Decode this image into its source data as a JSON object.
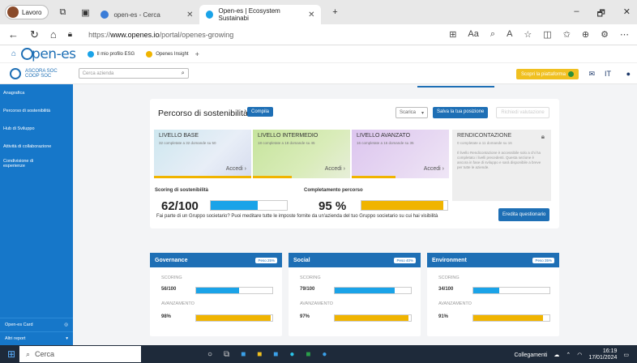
{
  "browser": {
    "profile_label": "Lavoro",
    "tabs": [
      {
        "label": "open-es - Cerca",
        "active": false
      },
      {
        "label": "Open-es | Ecosystem Sustainabi",
        "active": true
      }
    ],
    "new_tab": "+",
    "url_prefix": "https://",
    "url_domain": "www.openes.io",
    "url_path": "/portal/openes-growing",
    "window_controls": [
      "–",
      "🗗",
      "✕"
    ]
  },
  "app": {
    "logo": "pen-es",
    "tabs": [
      {
        "label": "Il mio profilo ESG"
      },
      {
        "label": "Openes Insight"
      }
    ],
    "add_tab": "+",
    "org_line1": "ASCORA SOC",
    "org_line2": "COOP SOC",
    "search_placeholder": "Cerca azienda",
    "yellow_button": "Scopri la piattaforma",
    "lang": "IT"
  },
  "sidebar": {
    "items": [
      {
        "label": "Anagrafica"
      },
      {
        "label": "Percorso di sostenibilità"
      },
      {
        "label": "Hub di Sviluppo"
      },
      {
        "label": "Attività di collaborazione"
      },
      {
        "label": "Condivisione di esperienze"
      }
    ],
    "bottom": [
      {
        "label": "Open-es Card"
      },
      {
        "label": "Altri report"
      }
    ]
  },
  "main": {
    "title": "Percorso di sostenibilità",
    "compila": "Compila",
    "select": "Scarica",
    "vai_btn": "Salva la tua posizione",
    "ghost_btn": "Richiedi valutazione",
    "levels": [
      {
        "title": "LIVELLO BASE",
        "sub": "32 completate a 32 domande su 50",
        "acc": "Accedi ›",
        "progress": 1.0
      },
      {
        "title": "LIVELLO INTERMEDIO",
        "sub": "18 completate a 18 domande su 45",
        "acc": "Accedi ›",
        "progress": 0.4
      },
      {
        "title": "LIVELLO AVANZATO",
        "sub": "16 completate a 16 domande su 35",
        "acc": "Accedi ›",
        "progress": 0.45
      }
    ],
    "rendicontazione": {
      "title": "RENDICONTAZIONE",
      "sub": "0 completate a 11 domande su 16",
      "body": "Il livello Rendicontazione è accessibile solo a chi ha completato i livelli precedenti. Questa sezione è ancora in fase di sviluppo e sarà disponibile a breve per tutte le aziende."
    },
    "scoring_label": "Scoring di sostenibilità",
    "scoring_value": "62/100",
    "scoring_progress": 0.62,
    "completion_label": "Completamento percorso",
    "completion_value": "95 %",
    "completion_progress": 0.95,
    "question": "Fai parte di un Gruppo societario? Puoi meditare tutte le imposte fornite da un'azienda del tuo Gruppo societario su cui hai visibilità",
    "question_btn": "Eredita questionario"
  },
  "pillars": [
    {
      "name": "Governance",
      "pill": "Peso 25%",
      "k1": "SCORING",
      "score": "56/100",
      "score_p": 0.56,
      "k2": "AVANZAMENTO",
      "adv": "98%",
      "adv_p": 0.98
    },
    {
      "name": "Social",
      "pill": "Peso 40%",
      "k1": "SCORING",
      "score": "79/100",
      "score_p": 0.79,
      "k2": "AVANZAMENTO",
      "adv": "97%",
      "adv_p": 0.97
    },
    {
      "name": "Environment",
      "pill": "Peso 35%",
      "k1": "SCORING",
      "score": "34/100",
      "score_p": 0.34,
      "k2": "AVANZAMENTO",
      "adv": "91%",
      "adv_p": 0.91
    }
  ],
  "taskbar": {
    "search": "Cerca",
    "tray_label": "Collegamenti",
    "time": "16:19",
    "date": "17/01/2024"
  },
  "colors": {
    "brand_blue": "#1e6fb5",
    "progress_blue": "#1aa3e8",
    "progress_yellow": "#f0b400"
  }
}
